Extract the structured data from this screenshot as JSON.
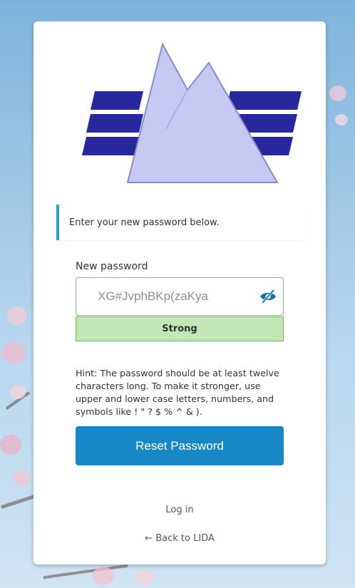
{
  "message": {
    "text": "Enter your new password below."
  },
  "form": {
    "password_label": "New password",
    "password_value": "XG#JvphBKp(zaKya",
    "strength_label": "Strong",
    "hint": "Hint: The password should be at least twelve characters long. To make it stronger, use upper and lower case letters, numbers, and symbols like ! \" ? $ % ^ & ).",
    "submit_label": "Reset Password"
  },
  "links": {
    "login": "Log in",
    "back": "← Back to LIDA"
  },
  "icons": {
    "visibility": "eye-slash-icon",
    "logo": "mountain-stripes-logo"
  },
  "colors": {
    "accent": "#1787c5",
    "notice_border": "#2a9cd6",
    "strength_bg": "#c3e6b7",
    "strength_border": "#71b65c",
    "logo_stripes": "#27289c",
    "logo_mountain": "#c7c8f3"
  }
}
